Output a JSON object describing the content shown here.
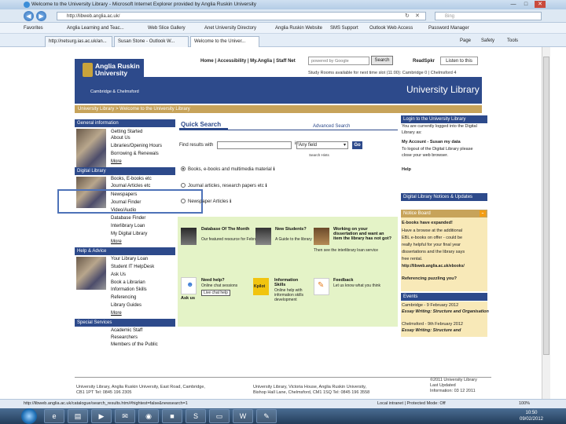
{
  "browser": {
    "title": "Welcome to the University Library - Microsoft Internet Explorer provided by Anglia Ruskin University",
    "url": "http://libweb.anglia.ac.uk/",
    "search_placeholder": "Bing",
    "favorites_label": "Favorites",
    "favorites": [
      "Anglia Learning and Teac...",
      "Web Slice Gallery",
      "Anet University Directory",
      "Anglia Ruskin Website",
      "SMS Support",
      "Outlook Web Access",
      "Password Manager"
    ],
    "tabs": [
      "http://netsurg.ias.ac.uk/an...",
      "Susan Stone - Outlook W...",
      "Welcome to the Univer..."
    ],
    "commands": [
      "Page",
      "Safety",
      "Tools"
    ],
    "status_url": "http://libweb.anglia.ac.uk/catalogue/search_results.htm/#hightest=false&newsearch=1",
    "status_zone": "Local intranet | Protected Mode: Off",
    "zoom": "100%"
  },
  "site": {
    "topnav": [
      "Home",
      "Accessibility",
      "My.Anglia",
      "Staff Net"
    ],
    "gsearch_placeholder": "powered by Google",
    "search_button": "Search",
    "readspeaker": "ReadSpkr",
    "listen": "Listen to this",
    "study_info": "Study Rooms available for next time slot (11:00): Cambridge 0 | Chelmsford 4",
    "uni_name_line1": "Anglia Ruskin",
    "uni_name_line2": "University",
    "campus": "Cambridge & Chelmsford",
    "library_title": "University Library",
    "breadcrumb": "University Library > Welcome to the University Library"
  },
  "left": {
    "sections": [
      {
        "title": "General information",
        "links": [
          "Getting Started",
          "About Us",
          "Libraries/Opening Hours",
          "Borrowing & Renewals",
          "More"
        ]
      },
      {
        "title": "Digital Library",
        "links": [
          "Books, E-books etc",
          "Journal Articles etc",
          "Newspapers",
          "Journal Finder",
          "Video/Audio",
          "Database Finder",
          "Interlibrary Loan",
          "My Digital Library",
          "More"
        ]
      },
      {
        "title": "Help & Advice",
        "links": [
          "Your Library Loan",
          "Student IT HelpDesk",
          "Ask Us",
          "Book a Librarian",
          "Information Skills",
          "Referencing",
          "Library Guides",
          "More"
        ]
      },
      {
        "title": "Special Services",
        "links": [
          "Academic Staff",
          "Researchers",
          "Members of the Public"
        ]
      }
    ]
  },
  "quicksearch": {
    "tab": "Quick Search",
    "advanced": "Advanced Search",
    "find_label": "Find results with",
    "in_label": "in",
    "field_value": "Any field",
    "go": "Go",
    "help": "Search Hints",
    "options": [
      "Books, e-books and multimedia material",
      "Journal articles, research papers etc",
      "Newspaper Articles"
    ]
  },
  "promo": [
    {
      "title": "Database Of The Month",
      "text": "Our featured resource for February"
    },
    {
      "title": "New Students?",
      "text": "A Guide to the library"
    },
    {
      "title": "Working on your dissertation and want an item the library has not got?",
      "text": "Then see the interlibrary loan service"
    },
    {
      "title": "Need help?",
      "text": "Online chat sessions",
      "extra": "Live chat help",
      "caption": "Ask us"
    },
    {
      "title": "Information Skills",
      "text": "Online help with information skills development",
      "caption": "Kpilot"
    },
    {
      "title": "Feedback",
      "text": "Let us know what you think"
    }
  ],
  "right": {
    "login_title": "Login to the University Library",
    "login_lines": [
      "You are currently logged into the Digital",
      "Library as:",
      "My Account - Susan my data",
      "To logout of the Digital Library please",
      "close your web browser."
    ],
    "help": "Help",
    "notices_title": "Digital Library Notices & Updates",
    "notice_board": "Notice Board",
    "notice_lines": [
      "E-books have expanded!",
      "Have a browse at the additional",
      "EBL e-books on offer - could be",
      "really helpful for your final year",
      "dissertations and the library says",
      "free rental.",
      "http://libweb.anglia.ac.uk/ebooks/",
      "Referencing puzzling you?"
    ],
    "events_title": "Events",
    "events": [
      "Cambridge - 9 February 2012",
      "Essay Writing: Structure and Organisation",
      "Chelmsford - 9th February 2012",
      "Essay Writing: Structure and"
    ]
  },
  "footer": {
    "col1": [
      "University Library, Anglia Ruskin University, East Road, Cambridge,",
      "CB1 1PT  Tel: 0845 196 2305"
    ],
    "col2": [
      "University Library, Victoria House, Anglia Ruskin University,",
      "Bishop Hall Lane, Chelmsford, CM1 1SQ  Tel: 0845 196 3558"
    ],
    "col3": [
      "©2011 University Library",
      "Last Updated",
      "Information: 03 12 2011"
    ]
  },
  "clock": {
    "time": "10:50",
    "date": "09/02/2012"
  },
  "colors": {
    "navy": "#2d4a8b",
    "gold": "#c7a35a",
    "promo_green": "#e4f3c7",
    "notice_yellow": "#f8e9b8"
  }
}
